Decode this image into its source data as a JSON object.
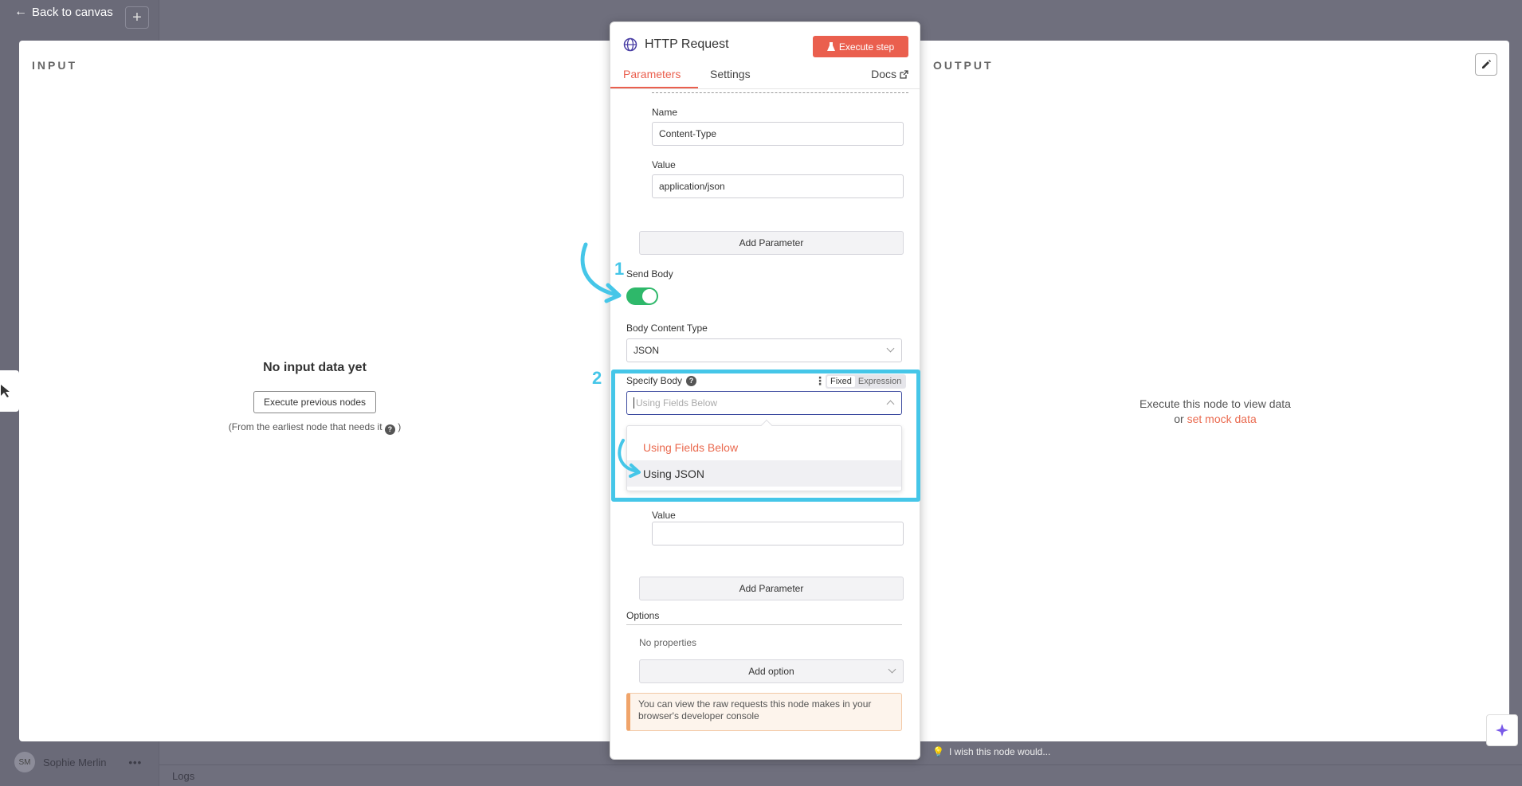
{
  "background": {
    "back_label": "Back to canvas",
    "user_initials": "SM",
    "user_name": "Sophie Merlin",
    "logs_label": "Logs",
    "wish_text": "I wish this node would..."
  },
  "input_panel": {
    "title": "INPUT",
    "empty_title": "No input data yet",
    "execute_previous": "Execute previous nodes",
    "note_before": "(From the earliest node that needs it",
    "note_after": ")"
  },
  "output_panel": {
    "title": "OUTPUT",
    "empty_line1": "Execute this node to view data",
    "empty_or": "or",
    "mock_link": "set mock data"
  },
  "node": {
    "title": "HTTP Request",
    "execute_step": "Execute step",
    "tabs": [
      "Parameters",
      "Settings"
    ],
    "docs": "Docs",
    "header_param": {
      "name_label": "Name",
      "name_value": "Content-Type",
      "value_label": "Value",
      "value_value": "application/json"
    },
    "add_parameter": "Add Parameter",
    "send_body_label": "Send Body",
    "send_body_on": true,
    "body_content_type_label": "Body Content Type",
    "body_content_type_value": "JSON",
    "specify_body_label": "Specify Body",
    "fixed_label": "Fixed",
    "expression_label": "Expression",
    "specify_body_placeholder": "Using Fields Below",
    "specify_body_options": [
      "Using Fields Below",
      "Using JSON"
    ],
    "value_label2": "Value",
    "add_parameter2": "Add Parameter",
    "options_title": "Options",
    "no_properties": "No properties",
    "add_option": "Add option",
    "notice": "You can view the raw requests this node makes in your browser's developer console"
  },
  "annotations": {
    "step1": "1",
    "step2": "2",
    "highlight_color": "#45c6e8"
  },
  "colors": {
    "accent": "#ea5f4e",
    "toggle_on": "#2eb86a"
  }
}
